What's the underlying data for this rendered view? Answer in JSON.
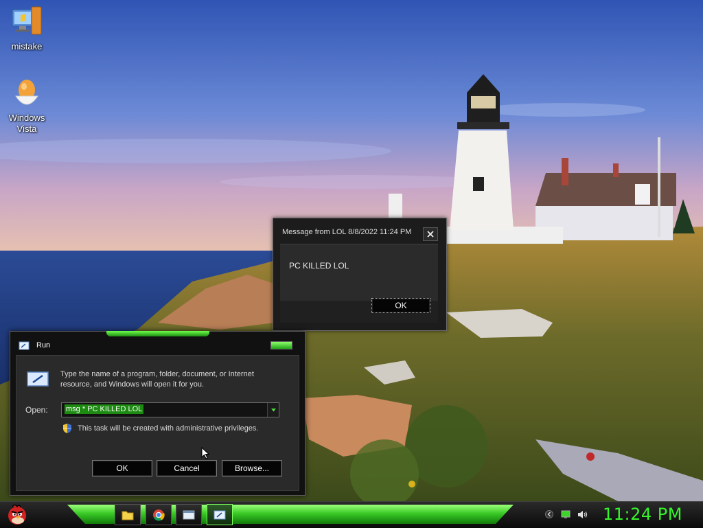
{
  "desktop": {
    "icons": [
      {
        "label": "mistake",
        "icon": "computer-with-shield-icon"
      },
      {
        "label": "Windows\nVista",
        "icon": "egg-icon"
      }
    ]
  },
  "message_box": {
    "title": "Message from LOL 8/8/2022 11:24 PM",
    "text": "PC KILLED LOL",
    "ok_label": "OK"
  },
  "run_dialog": {
    "title": "Run",
    "description": "Type the name of a program, folder, document, or Internet resource, and Windows will open it for you.",
    "open_label": "Open:",
    "open_value": "msg * PC KILLED LOL",
    "admin_note": "This task will be created with administrative privileges.",
    "buttons": {
      "ok": "OK",
      "cancel": "Cancel",
      "browse": "Browse..."
    }
  },
  "taskbar": {
    "start_icon": "angry-bird-icon",
    "pinned": [
      {
        "icon": "folder-icon"
      },
      {
        "icon": "chrome-icon"
      },
      {
        "icon": "window-icon"
      },
      {
        "icon": "run-icon",
        "active": true
      }
    ],
    "tray": [
      "chevron-left-icon",
      "network-icon",
      "volume-icon"
    ],
    "clock": "11:24 PM"
  },
  "colors": {
    "accent": "#36f52b",
    "dialog_bg": "#2a2a2a",
    "selection": "#1d8a12"
  }
}
